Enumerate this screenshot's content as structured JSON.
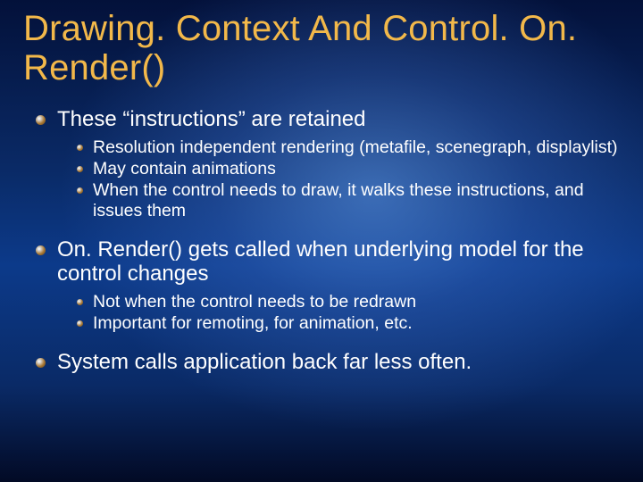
{
  "title": "Drawing. Context And Control. On. Render()",
  "bullets": [
    {
      "text": "These “instructions” are retained",
      "sub": [
        "Resolution independent rendering (metafile, scenegraph, displaylist)",
        "May contain animations",
        "When the control needs to draw, it walks these instructions, and issues them"
      ]
    },
    {
      "text": "On. Render() gets called when underlying model for the control changes",
      "sub": [
        "Not when the control needs to be redrawn",
        "Important for remoting, for animation, etc."
      ]
    },
    {
      "text": "System calls application back far less often.",
      "sub": []
    }
  ]
}
